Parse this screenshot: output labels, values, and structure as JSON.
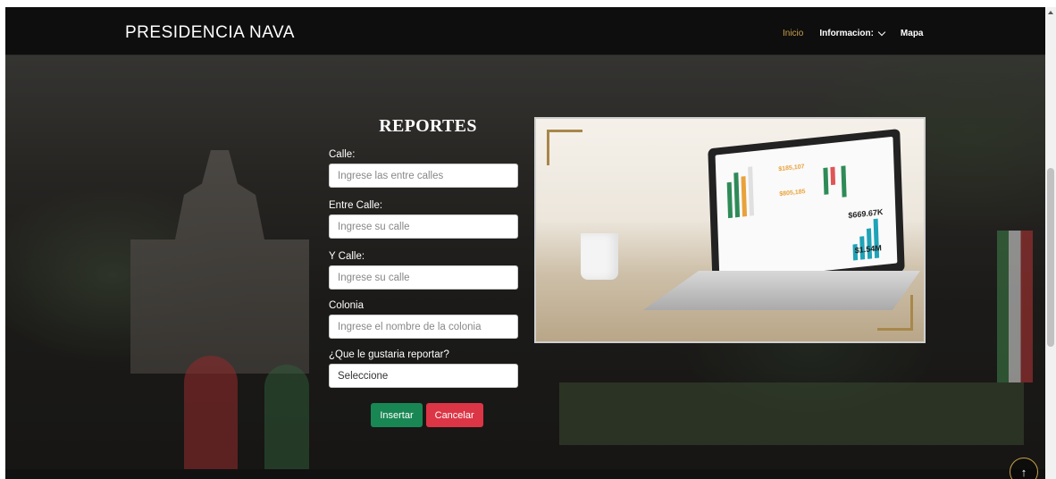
{
  "navbar": {
    "brand": "PRESIDENCIA NAVA",
    "items": [
      {
        "label": "Inicio",
        "active": true
      },
      {
        "label": "Informacion:",
        "dropdown": true
      },
      {
        "label": "Mapa"
      }
    ]
  },
  "form": {
    "title": "REPORTES",
    "fields": [
      {
        "label": "Calle:",
        "placeholder": "Ingrese las entre calles"
      },
      {
        "label": "Entre Calle:",
        "placeholder": "Ingrese su calle"
      },
      {
        "label": "Y Calle:",
        "placeholder": "Ingrese su calle"
      },
      {
        "label": "Colonia",
        "placeholder": "Ingrese el nombre de la colonia"
      },
      {
        "label": "¿Que le gustaria reportar?",
        "selected": "Seleccione"
      }
    ],
    "buttons": {
      "submit": "Insertar",
      "cancel": "Cancelar"
    }
  },
  "image": {
    "kpis": [
      "$669.67K",
      "$1.54M",
      "$185,107",
      "$805,185"
    ]
  },
  "colors": {
    "accent": "#c9a14a",
    "submit": "#198754",
    "cancel": "#dc3545",
    "navbar": "#0e0e0e"
  },
  "icons": [
    "chevron-down-icon",
    "arrow-up-icon"
  ]
}
